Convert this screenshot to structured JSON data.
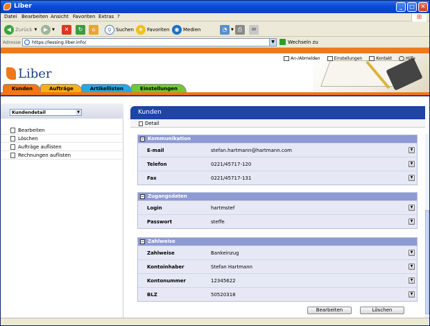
{
  "window": {
    "title": "Liber",
    "controls": {
      "minimize": "_",
      "maximize": "□",
      "close": "✕"
    }
  },
  "menu": [
    "Datei",
    "Bearbeiten",
    "Ansicht",
    "Favoriten",
    "Extras",
    "?"
  ],
  "toolbar": {
    "back": "Zurück",
    "search": "Suchen",
    "favorites": "Favoriten",
    "media": "Medien"
  },
  "address": {
    "label": "Adresse",
    "url": "https://lessing.liber.info/",
    "go": "Wechseln zu"
  },
  "toplinks": [
    "An-/Abmelden",
    "Einstellungen",
    "Kontakt",
    "Hilfe"
  ],
  "logo": "Liber",
  "tabs": [
    {
      "label": "Kunden",
      "color": "#f07818"
    },
    {
      "label": "Aufträge",
      "color": "#f5b015"
    },
    {
      "label": "Artikellisten",
      "color": "#27a7e5"
    },
    {
      "label": "Einstellungen",
      "color": "#74c636"
    }
  ],
  "sidebar": {
    "select": "Kundendetail",
    "items": [
      "Bearbeiten",
      "Löschen",
      "Aufträge auflisten",
      "Rechnungen auflisten"
    ]
  },
  "main": {
    "title": "Kunden",
    "sub": "Detail",
    "sections": [
      {
        "title": "Kommunikation",
        "rows": [
          {
            "k": "E-mail",
            "v": "stefan.hartmann@hartmann.com"
          },
          {
            "k": "Telefon",
            "v": "0221/45717-120"
          },
          {
            "k": "Fax",
            "v": "0221/45717-131"
          }
        ]
      },
      {
        "title": "Zugangsdaten",
        "rows": [
          {
            "k": "Login",
            "v": "hartmstef"
          },
          {
            "k": "Passwort",
            "v": "steffe"
          }
        ]
      },
      {
        "title": "Zahlweise",
        "rows": [
          {
            "k": "Zahlweise",
            "v": "Bankeinzug"
          },
          {
            "k": "Kontoinhaber",
            "v": "Stefan Hartmann"
          },
          {
            "k": "Kontonummer",
            "v": "12345622"
          },
          {
            "k": "BLZ",
            "v": "50520318"
          }
        ]
      }
    ],
    "buttons": {
      "edit": "Bearbeiten",
      "delete": "Löschen"
    }
  }
}
